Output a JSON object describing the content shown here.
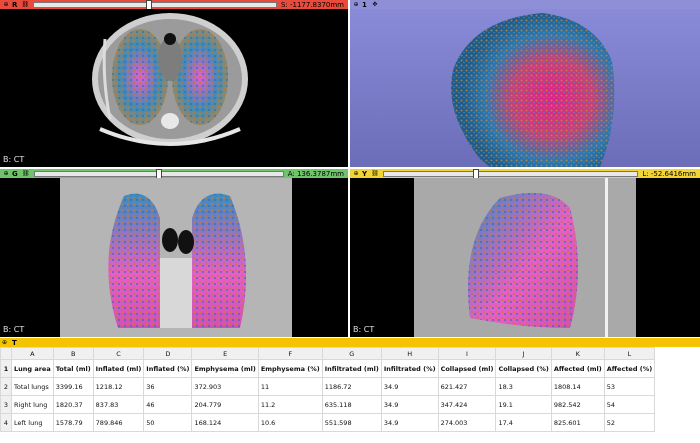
{
  "colors": {
    "red_bar": "#e84b3c",
    "purple_bar": "#8f8fd8",
    "green_bar": "#6fc36a",
    "yellow_bar": "#f0d437",
    "table_bar": "#f5c400"
  },
  "views": {
    "red": {
      "label": "R",
      "value": "S: -1177.8370mm",
      "corner": "B: CT"
    },
    "three_d": {
      "label": "1"
    },
    "green": {
      "label": "G",
      "value": "A: 136.3787mm",
      "corner": "B: CT"
    },
    "yellow": {
      "label": "Y",
      "value": "L: -52.6416mm",
      "corner": "B: CT"
    }
  },
  "table_panel": {
    "label": "T"
  },
  "table": {
    "col_letters": [
      "A",
      "B",
      "C",
      "D",
      "E",
      "F",
      "G",
      "H",
      "I",
      "J",
      "K",
      "L"
    ],
    "headers": [
      "Lung area",
      "Total (ml)",
      "Inflated (ml)",
      "Inflated (%)",
      "Emphysema (ml)",
      "Emphysema (%)",
      "Infiltrated (ml)",
      "Infiltrated (%)",
      "Collapsed (ml)",
      "Collapsed (%)",
      "Affected (ml)",
      "Affected (%)"
    ],
    "rows": [
      [
        "Total lungs",
        "3399.16",
        "1218.12",
        "36",
        "372.903",
        "11",
        "1186.72",
        "34.9",
        "621.427",
        "18.3",
        "1808.14",
        "53"
      ],
      [
        "Right lung",
        "1820.37",
        "837.83",
        "46",
        "204.779",
        "11.2",
        "635.118",
        "34.9",
        "347.424",
        "19.1",
        "982.542",
        "54"
      ],
      [
        "Left lung",
        "1578.79",
        "789.846",
        "50",
        "168.124",
        "10.6",
        "551.598",
        "34.9",
        "274.003",
        "17.4",
        "825.601",
        "52"
      ]
    ]
  }
}
